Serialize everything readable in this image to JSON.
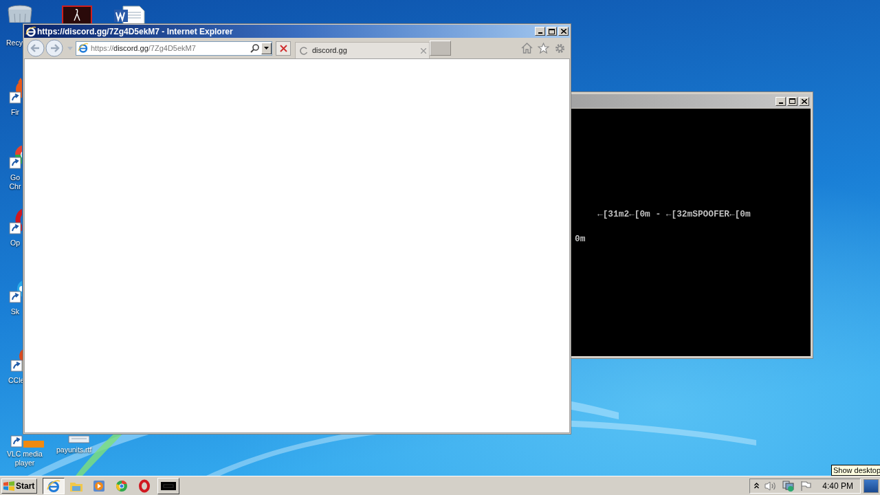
{
  "desktop_icons": [
    {
      "kind": "recycle",
      "label": "Recy"
    },
    {
      "kind": "pdf"
    },
    {
      "kind": "word"
    },
    {
      "kind": "firefox",
      "label": "Fir"
    },
    {
      "kind": "chrome",
      "label": "Go\nChr"
    },
    {
      "kind": "opera",
      "label": "Op"
    },
    {
      "kind": "skype",
      "label": "Sk"
    },
    {
      "kind": "ccleaner",
      "label": "CCle"
    },
    {
      "kind": "vlc",
      "label": "VLC media\nplayer"
    },
    {
      "kind": "document",
      "label": "payunits.rtf"
    }
  ],
  "browser": {
    "title": "https://discord.gg/7Zg4D5ekM7 - Internet Explorer",
    "address": {
      "scheme": "https://",
      "domain": "discord.gg",
      "path": "/7Zg4D5ekM7"
    },
    "tab": {
      "label": "discord.gg",
      "loading": true
    }
  },
  "console": {
    "lines": [
      "←[31m2←[0m - ←[32mSPOOFER←[0m",
      "0m"
    ]
  },
  "taskbar": {
    "start": "Start",
    "apps": [
      {
        "kind": "ie",
        "selected": true
      },
      {
        "kind": "explorer",
        "selected": false
      },
      {
        "kind": "media",
        "selected": false
      },
      {
        "kind": "chrome",
        "selected": false
      },
      {
        "kind": "opera",
        "selected": false
      },
      {
        "kind": "console",
        "selected": false
      }
    ],
    "clock": "4:40 PM",
    "tooltip": "Show desktop"
  }
}
